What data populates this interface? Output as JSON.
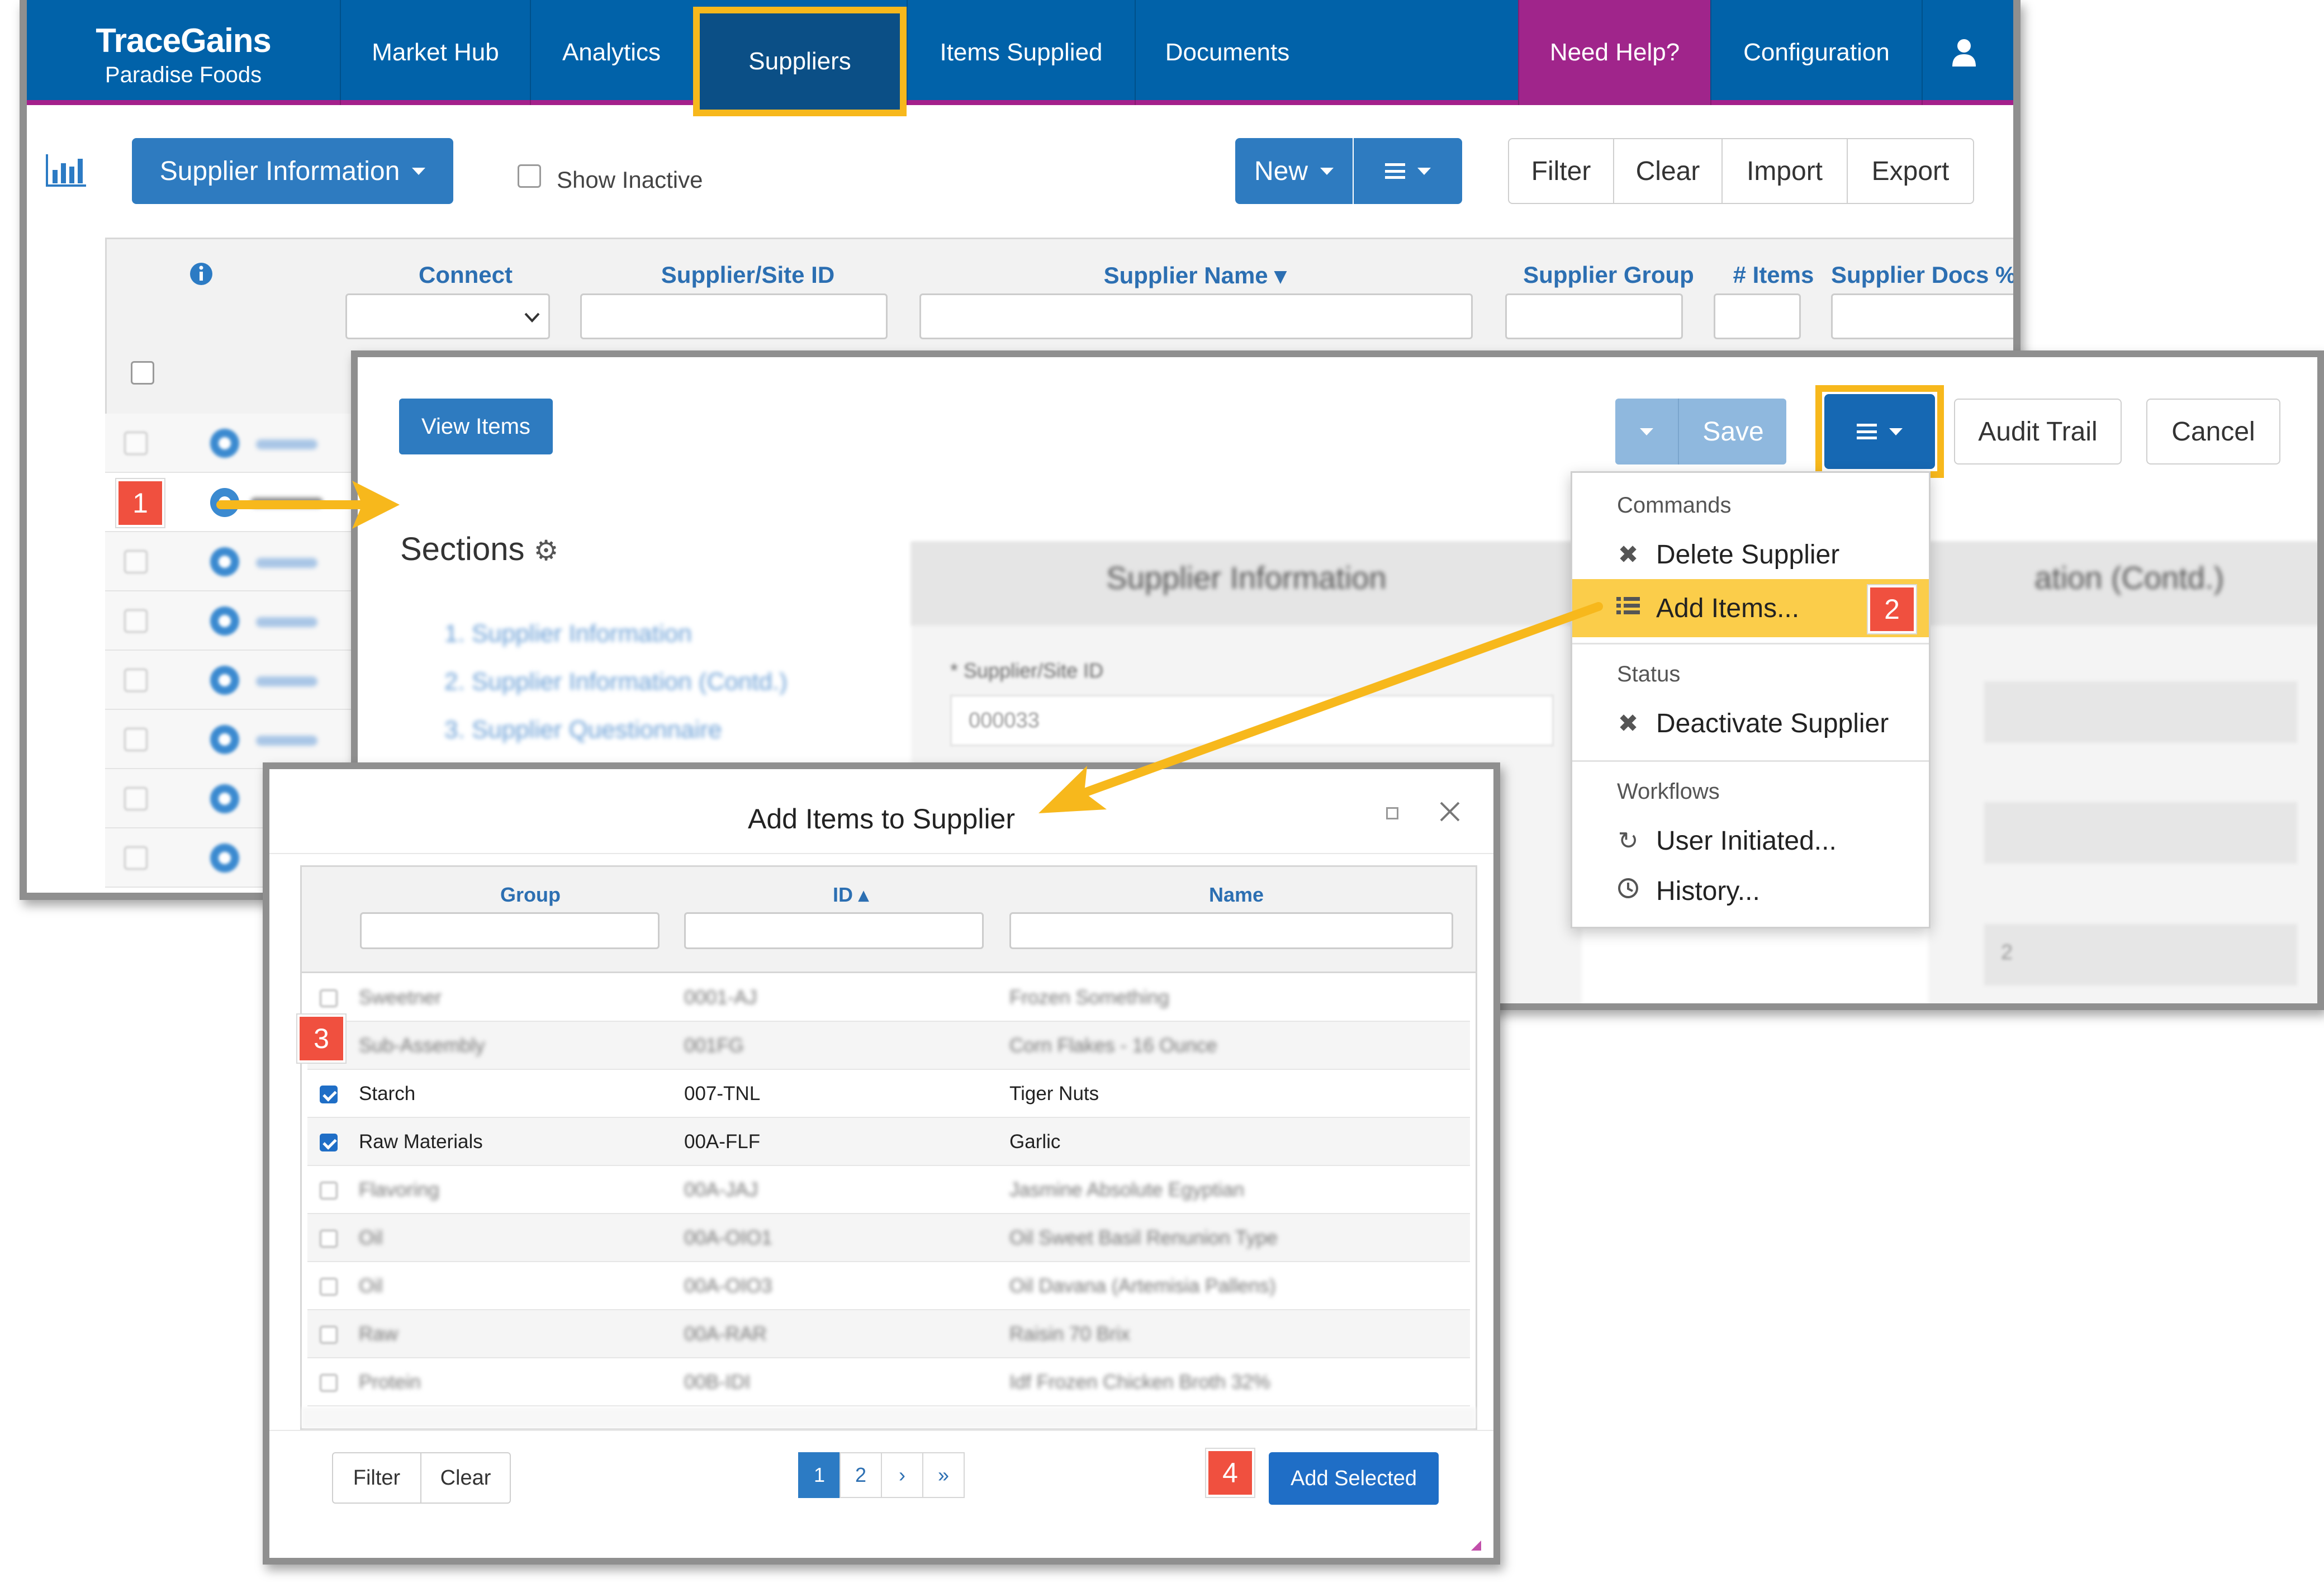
{
  "nav": {
    "brand_title": "TraceGains",
    "brand_subtitle": "Paradise Foods",
    "items": [
      "Market Hub",
      "Analytics",
      "Suppliers",
      "Items Supplied",
      "Documents"
    ],
    "help": "Need Help?",
    "configuration": "Configuration",
    "user_icon": "user-icon"
  },
  "toolbar": {
    "view_select": "Supplier Information",
    "show_inactive": "Show Inactive",
    "new_label": "New",
    "filter": "Filter",
    "clear": "Clear",
    "import": "Import",
    "export": "Export"
  },
  "grid": {
    "columns": [
      "Connect",
      "Supplier/Site ID",
      "Supplier Name ▾",
      "Supplier Group",
      "# Items",
      "Supplier Docs %"
    ]
  },
  "editor": {
    "view_items": "View Items",
    "save": "Save",
    "audit_trail": "Audit Trail",
    "cancel": "Cancel",
    "sections_title": "Sections",
    "section_links": [
      "1. Supplier Information",
      "2. Supplier Information (Contd.)",
      "3. Supplier Questionnaire"
    ],
    "panel_left": "Supplier Information",
    "panel_right": "ation (Contd.)",
    "field_label": "* Supplier/Site ID",
    "field_value": "000033",
    "field_value_right": "2"
  },
  "menu": {
    "commands_heading": "Commands",
    "delete_supplier": "Delete Supplier",
    "add_items": "Add Items...",
    "status_heading": "Status",
    "deactivate_supplier": "Deactivate Supplier",
    "workflows_heading": "Workflows",
    "user_initiated": "User Initiated...",
    "history": "History..."
  },
  "modal": {
    "title": "Add Items to Supplier",
    "columns": [
      "Group",
      "ID ▴",
      "Name"
    ],
    "rows": [
      {
        "group": "Sweetner",
        "id": "0001-AJ",
        "name": "Frozen Something",
        "checked": false
      },
      {
        "group": "Sub-Assembly",
        "id": "001FG",
        "name": "Corn Flakes - 16 Ounce",
        "checked": false
      },
      {
        "group": "Starch",
        "id": "007-TNL",
        "name": "Tiger Nuts",
        "checked": true
      },
      {
        "group": "Raw Materials",
        "id": "00A-FLF",
        "name": "Garlic",
        "checked": true
      },
      {
        "group": "Flavoring",
        "id": "00A-JAJ",
        "name": "Jasmine Absolute Egyptian",
        "checked": false
      },
      {
        "group": "Oil",
        "id": "00A-OIO1",
        "name": "Oil Sweet Basil Renunion Type",
        "checked": false
      },
      {
        "group": "Oil",
        "id": "00A-OIO3",
        "name": "Oil Davana (Artemisia Pallens)",
        "checked": false
      },
      {
        "group": "Raw",
        "id": "00A-RAR",
        "name": "Raisin 70 Brix",
        "checked": false
      },
      {
        "group": "Protein",
        "id": "00B-IDI",
        "name": "Idf Frozen Chicken Broth 32%",
        "checked": false
      }
    ],
    "filter": "Filter",
    "clear": "Clear",
    "pages": [
      "1",
      "2",
      "›",
      "»"
    ],
    "add_selected": "Add Selected"
  },
  "callouts": [
    "1",
    "2",
    "3",
    "4"
  ],
  "colors": {
    "nav_blue": "#0162a9",
    "nav_border": "#a4208b",
    "help_magenta": "#a0258b",
    "highlight_orange": "#f7b81c",
    "button_blue": "#2e7bc0",
    "menu_highlight": "#fbcd4a",
    "callout_red": "#f0503f"
  }
}
